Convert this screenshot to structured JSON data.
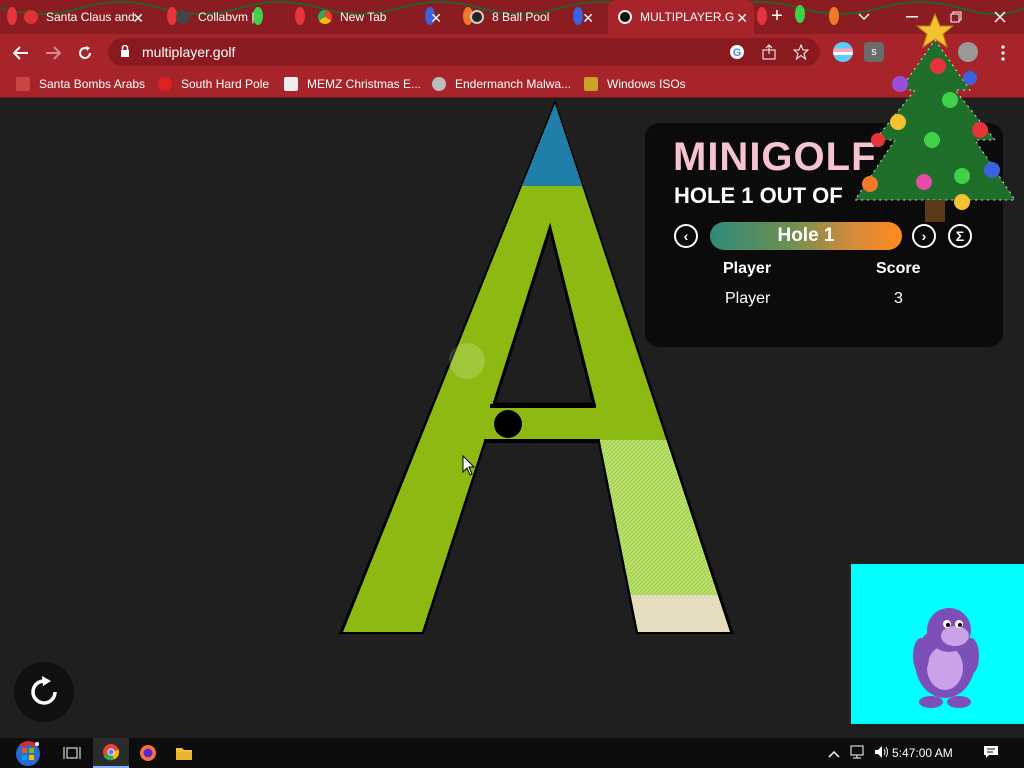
{
  "browser": {
    "tabs": [
      {
        "title": "Santa Claus and",
        "active": false
      },
      {
        "title": "Collabvm |",
        "active": false
      },
      {
        "title": "New Tab",
        "active": false
      },
      {
        "title": "8 Ball Pool",
        "active": false
      },
      {
        "title": "MULTIPLAYER.G",
        "active": true
      }
    ],
    "new_tab_label": "+",
    "url": "multiplayer.golf",
    "bookmarks": [
      {
        "label": "Santa Bombs Arabs"
      },
      {
        "label": "South Hard Pole"
      },
      {
        "label": "MEMZ Christmas E..."
      },
      {
        "label": "Endermanch Malwa..."
      },
      {
        "label": "Windows ISOs"
      }
    ]
  },
  "game": {
    "logo": "MINIGOLF",
    "hole_title": "HOLE 1 OUT OF",
    "hole_selector_label": "Hole 1",
    "prev_glyph": "‹",
    "next_glyph": "›",
    "sum_glyph": "Σ",
    "scoreboard": {
      "headers": [
        "Player",
        "Score"
      ],
      "rows": [
        {
          "player": "Player",
          "score": "3"
        }
      ]
    },
    "course_letter": "A"
  },
  "taskbar": {
    "clock": "5:47:00 AM"
  },
  "colors": {
    "tab_strip": "#8a1c22",
    "toolbar": "#a8242b",
    "page_bg": "#1f1f1f",
    "fairway": "#8cba12",
    "water": "#1f7fa8",
    "sand": "#e4dcbc",
    "rough": "#a6d44a",
    "logo": "#f6c4cf",
    "bonzi_bg": "#00ffff"
  },
  "icons": {
    "back": "back-arrow-icon",
    "forward": "forward-arrow-icon",
    "reload": "reload-icon",
    "lock": "lock-icon",
    "google": "google-icon",
    "share": "share-icon",
    "bookmark_star": "star-icon",
    "menu": "kebab-menu-icon",
    "reset": "reset-icon",
    "start": "windows-start-icon"
  }
}
